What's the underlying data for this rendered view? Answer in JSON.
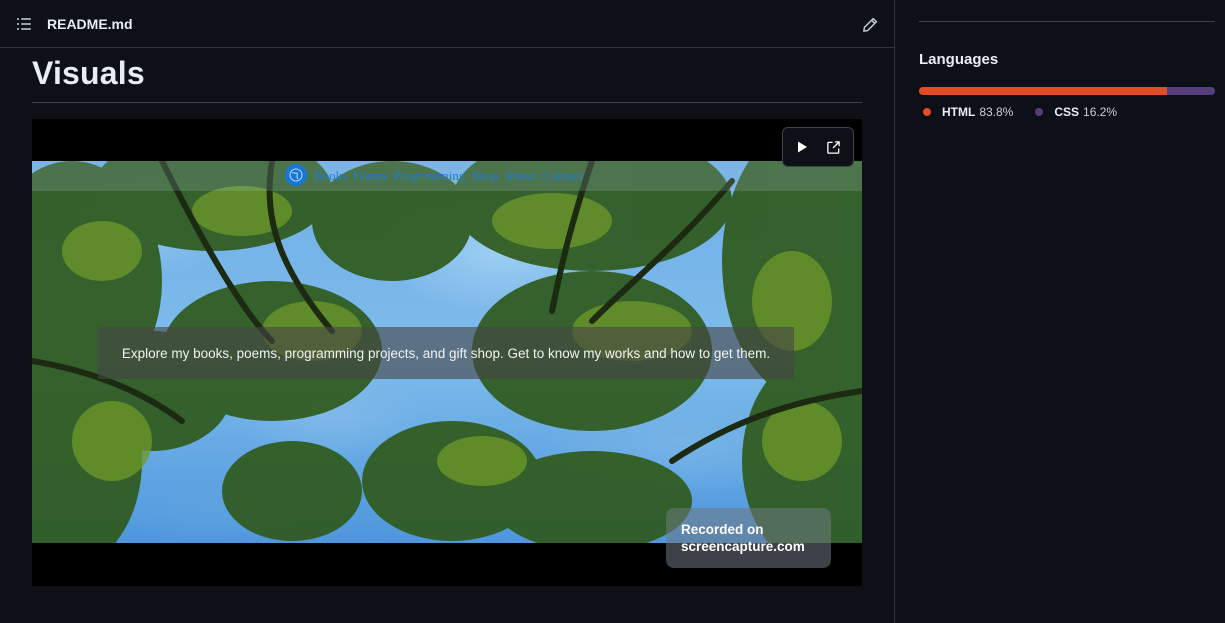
{
  "readme": {
    "file_name": "README.md",
    "outline_icon": "list-unordered-icon",
    "edit_icon": "pencil-icon",
    "heading": "Visuals"
  },
  "video": {
    "controls": {
      "play_icon": "play-icon",
      "open_icon": "link-external-icon"
    },
    "site_nav": {
      "logo_icon": "globe-icon",
      "links": [
        "Books",
        "Poems",
        "Programming",
        "Shop",
        "About",
        "Contact"
      ],
      "link_color": "#1f7ad8"
    },
    "tagline": "Explore my books, poems, programming projects, and gift shop. Get to know my works and how to get them.",
    "watermark": {
      "line1": "Recorded on",
      "line2": "screencapture.com"
    }
  },
  "sidebar": {
    "languages_title": "Languages",
    "languages": [
      {
        "name": "HTML",
        "percent_label": "83.8%",
        "percent": 83.8,
        "color": "#e34c26"
      },
      {
        "name": "CSS",
        "percent_label": "16.2%",
        "percent": 16.2,
        "color": "#563d7c"
      }
    ]
  }
}
